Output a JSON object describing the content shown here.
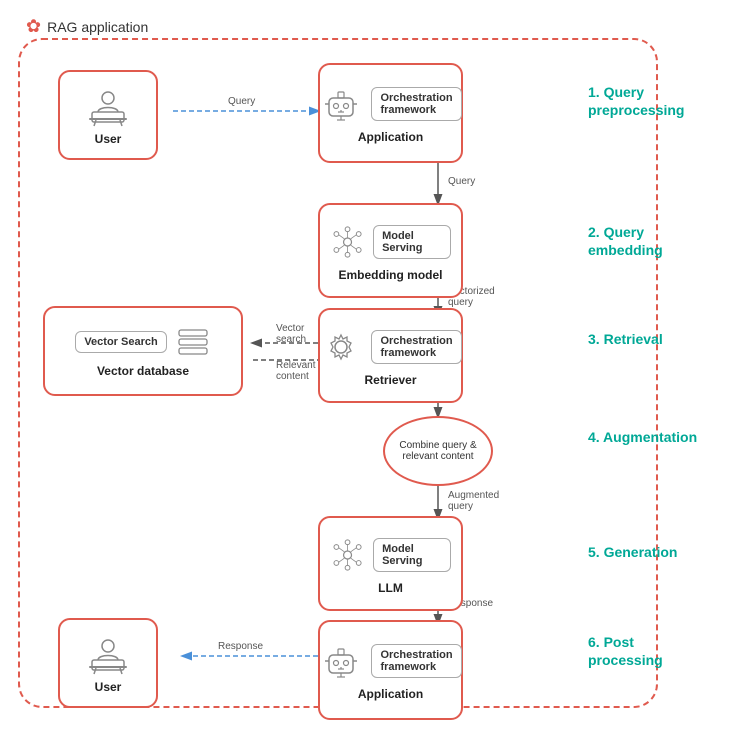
{
  "title": "RAG application",
  "steps": [
    {
      "number": "1.",
      "label": "Query\npreprocessing"
    },
    {
      "number": "2.",
      "label": "Query\nembedding"
    },
    {
      "number": "3.",
      "label": "Retrieval"
    },
    {
      "number": "4.",
      "label": "Augmentation"
    },
    {
      "number": "5.",
      "label": "Generation"
    },
    {
      "number": "6.",
      "label": "Post\nprocessing"
    }
  ],
  "nodes": {
    "user_top": {
      "label": "User"
    },
    "app_top": {
      "title": "Orchestration framework",
      "label": "Application"
    },
    "embedding": {
      "title": "Model Serving",
      "label": "Embedding model"
    },
    "vector_db": {
      "title": "Vector Search",
      "label": "Vector database"
    },
    "retriever": {
      "title": "Orchestration framework",
      "label": "Retriever"
    },
    "combine": {
      "label": "Combine\nquery &\nrelevant\ncontent"
    },
    "llm": {
      "title": "Model Serving",
      "label": "LLM"
    },
    "user_bottom": {
      "label": "User"
    },
    "app_bottom": {
      "title": "Orchestration framework",
      "label": "Application"
    }
  },
  "arrows": [
    {
      "label": "Query",
      "from": "user_top",
      "to": "app_top"
    },
    {
      "label": "Query",
      "from": "app_top",
      "to": "embedding"
    },
    {
      "label": "Vectorized\nquery",
      "from": "embedding",
      "to": "retriever"
    },
    {
      "label": "Vector\nsearch",
      "from": "retriever",
      "to": "vector_db"
    },
    {
      "label": "Relevant\ncontent",
      "from": "vector_db",
      "to": "retriever_back"
    },
    {
      "label": "Augmented\nquery",
      "from": "combine",
      "to": "llm"
    },
    {
      "label": "Response",
      "from": "llm",
      "to": "app_bottom"
    },
    {
      "label": "Response",
      "from": "app_bottom",
      "to": "user_bottom"
    }
  ]
}
